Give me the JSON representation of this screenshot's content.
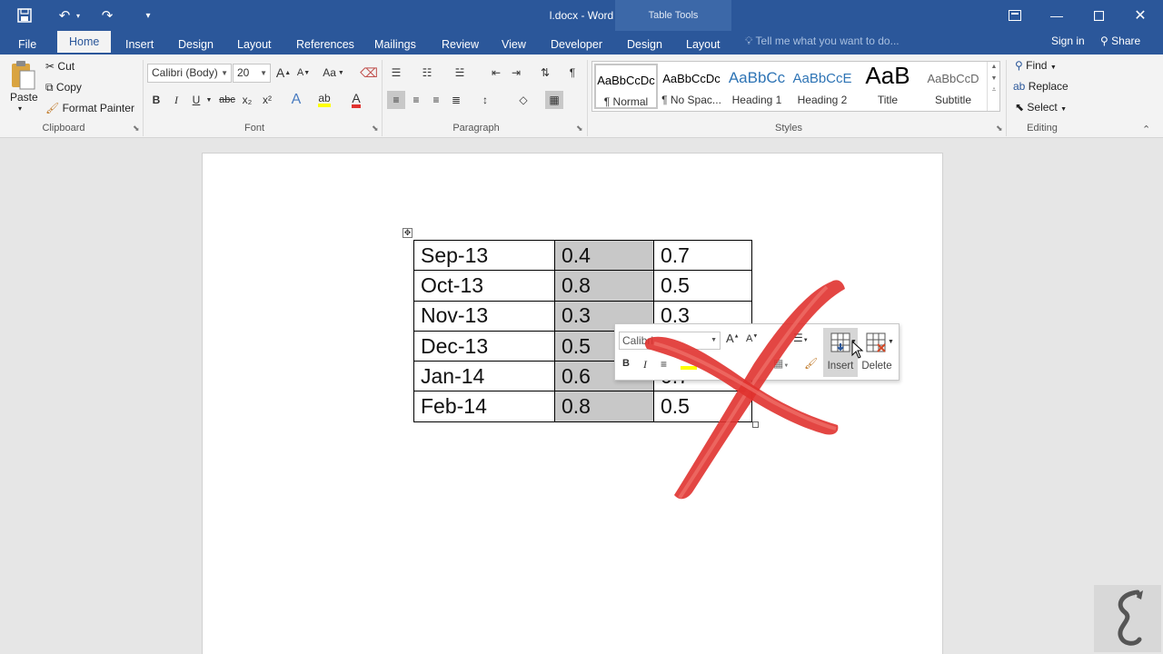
{
  "app": {
    "doc_title": "l.docx - Word",
    "context_group": "Table Tools"
  },
  "tabs": [
    {
      "label": "File"
    },
    {
      "label": "Home"
    },
    {
      "label": "Insert"
    },
    {
      "label": "Design"
    },
    {
      "label": "Layout"
    },
    {
      "label": "References"
    },
    {
      "label": "Mailings"
    },
    {
      "label": "Review"
    },
    {
      "label": "View"
    },
    {
      "label": "Developer"
    },
    {
      "label": "Design"
    },
    {
      "label": "Layout"
    }
  ],
  "tell_me": "Tell me what you want to do...",
  "account": {
    "signin": "Sign in",
    "share": "Share"
  },
  "clipboard": {
    "paste": "Paste",
    "cut": "Cut",
    "copy": "Copy",
    "format_painter": "Format Painter",
    "label": "Clipboard"
  },
  "font": {
    "name": "Calibri (Body)",
    "size": "20",
    "label": "Font",
    "bold": "B",
    "italic": "I",
    "underline": "U",
    "strike": "abc",
    "sub": "x₂",
    "sup": "x²",
    "grow": "A",
    "shrink": "A",
    "case": "Aa"
  },
  "paragraph": {
    "label": "Paragraph"
  },
  "styles": {
    "label": "Styles",
    "items": [
      {
        "sample": "AaBbCcDc",
        "name": "¶ Normal"
      },
      {
        "sample": "AaBbCcDc",
        "name": "¶ No Spac..."
      },
      {
        "sample": "AaBbCc",
        "name": "Heading 1"
      },
      {
        "sample": "AaBbCcE",
        "name": "Heading 2"
      },
      {
        "sample": "AaB",
        "name": "Title"
      },
      {
        "sample": "AaBbCcD",
        "name": "Subtitle"
      }
    ]
  },
  "editing": {
    "label": "Editing",
    "find": "Find",
    "replace": "Replace",
    "select": "Select"
  },
  "table": {
    "rows": [
      [
        "Sep-13",
        "0.4",
        "0.7"
      ],
      [
        "Oct-13",
        "0.8",
        "0.5"
      ],
      [
        "Nov-13",
        "0.3",
        "0.3"
      ],
      [
        "Dec-13",
        "0.5",
        ""
      ],
      [
        "Jan-14",
        "0.6",
        "0.7"
      ],
      [
        "Feb-14",
        "0.8",
        "0.5"
      ]
    ]
  },
  "mini_toolbar": {
    "font": "Calibri",
    "insert": "Insert",
    "delete": "Delete",
    "bold": "B",
    "italic": "I"
  },
  "colors": {
    "word_blue": "#2b579a",
    "ribbon": "#f3f3f3",
    "shaded_cell": "#c8c8c8",
    "red_x": "#e0322f"
  }
}
